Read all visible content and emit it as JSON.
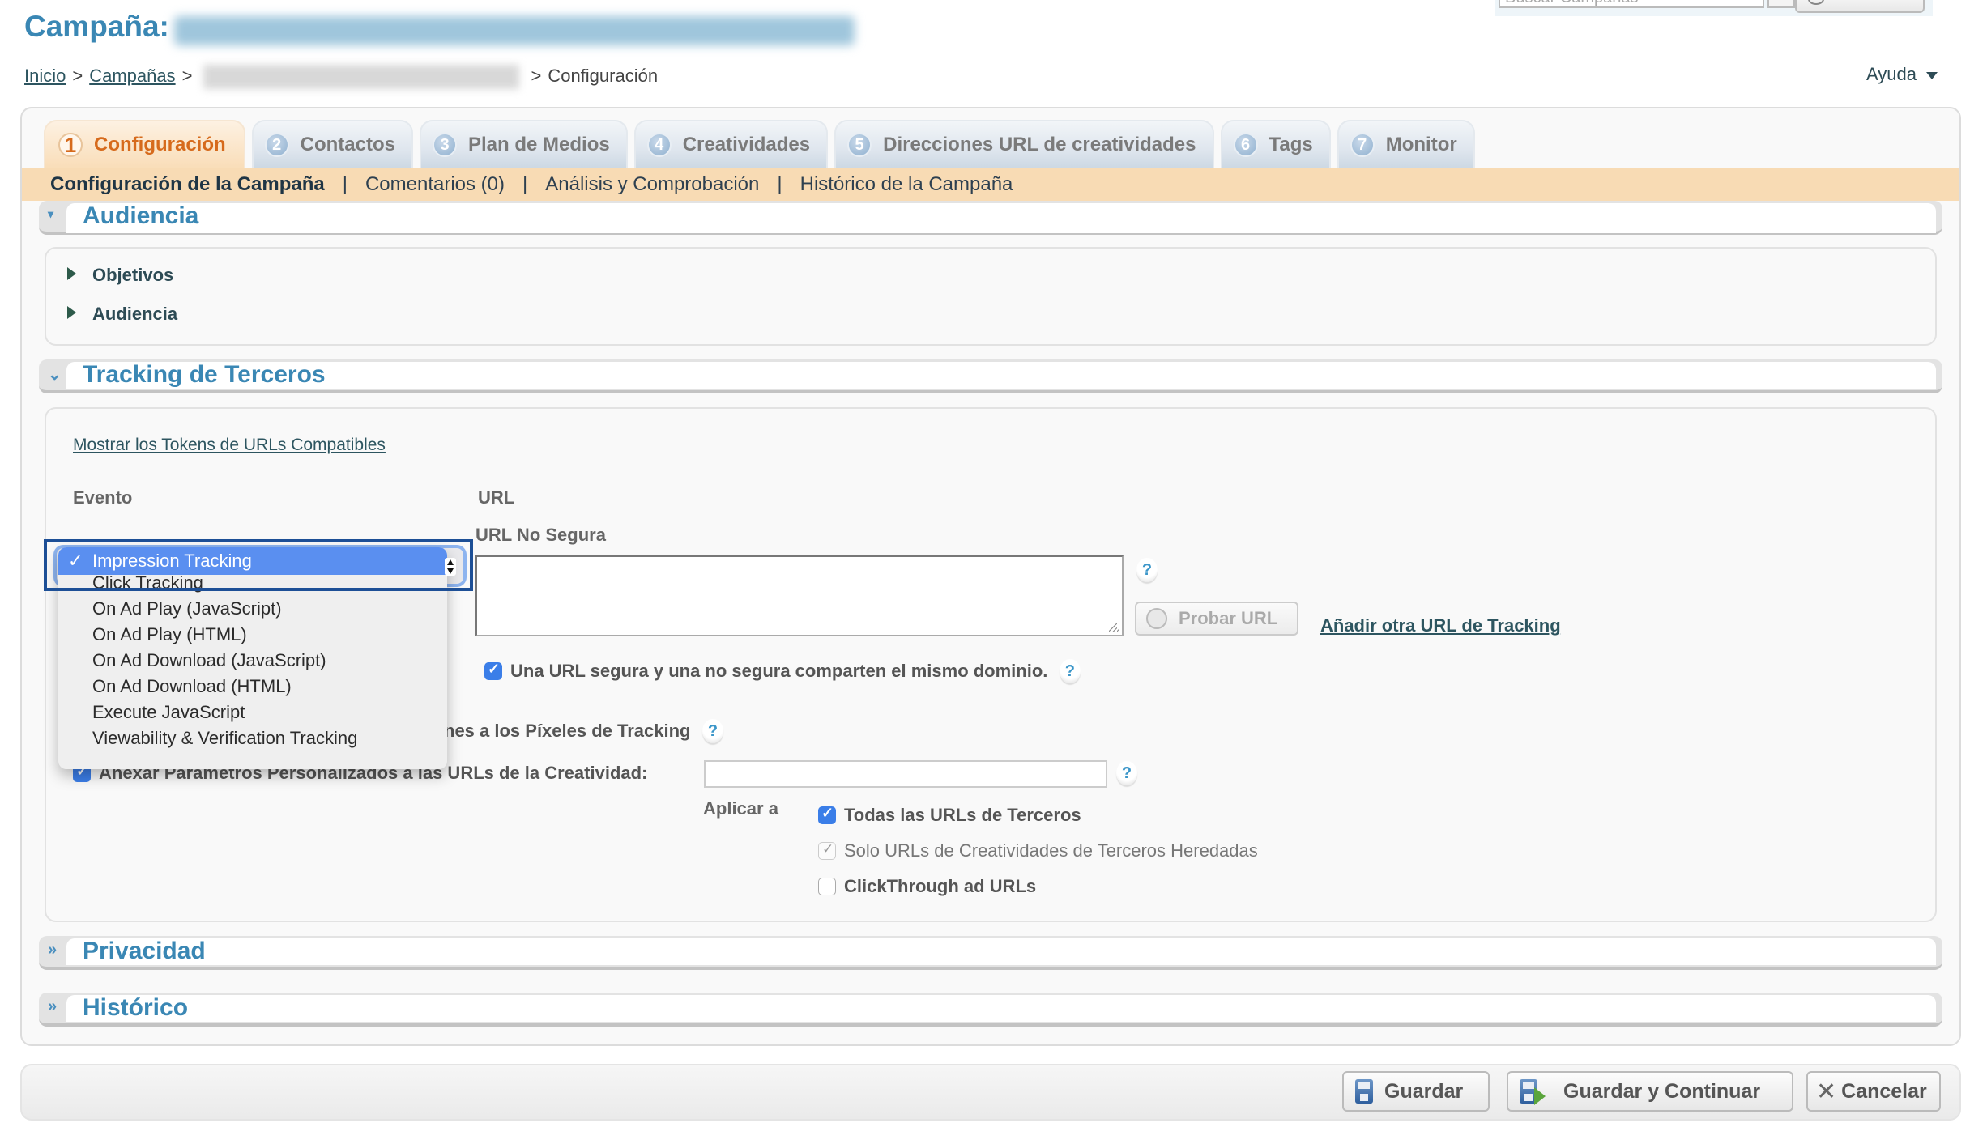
{
  "header": {
    "title_label": "Campaña:",
    "help_label": "Ayuda",
    "search_placeholder": "Buscar Campañas"
  },
  "breadcrumb": {
    "items": [
      "Inicio",
      "Campañas"
    ],
    "separator": ">",
    "current": "Configuración"
  },
  "tabs": [
    {
      "num": "1",
      "label": "Configuración",
      "active": true
    },
    {
      "num": "2",
      "label": "Contactos"
    },
    {
      "num": "3",
      "label": "Plan de Medios"
    },
    {
      "num": "4",
      "label": "Creatividades"
    },
    {
      "num": "5",
      "label": "Direcciones URL de creatividades"
    },
    {
      "num": "6",
      "label": "Tags"
    },
    {
      "num": "7",
      "label": "Monitor"
    }
  ],
  "subnav": {
    "items": [
      "Configuración de la Campaña",
      "Comentarios (0)",
      "Análisis y Comprobación",
      "Histórico de la Campaña"
    ],
    "separator": "|"
  },
  "sections": {
    "audiencia": {
      "title": "Audiencia",
      "children": [
        "Objetivos",
        "Audiencia"
      ]
    },
    "tracking": {
      "title": "Tracking de Terceros"
    },
    "privacidad": {
      "title": "Privacidad"
    },
    "historico": {
      "title": "Histórico"
    }
  },
  "tracking": {
    "tokens_link": "Mostrar los Tokens de URLs Compatibles",
    "col_event": "Evento",
    "col_url": "URL",
    "url_insecure_label": "URL No Segura",
    "url_insecure_value": "",
    "test_url_button": "Probar URL",
    "add_url_link": "Añadir otra URL de Tracking",
    "same_domain_label": "Una URL segura y una no segura comparten el mismo dominio.",
    "same_domain_checked": true,
    "pixels_label_visible": "nes a los Píxeles de Tracking",
    "append_params_label": "Anexar Parámetros Personalizados a las URLs de la Creatividad:",
    "append_params_checked": true,
    "append_params_value": "",
    "apply_to_label": "Aplicar a",
    "apply_options": [
      {
        "label": "Todas las URLs de Terceros",
        "state": "checked"
      },
      {
        "label": "Solo URLs de Creatividades de Terceros Heredadas",
        "state": "disabled-checked"
      },
      {
        "label": "ClickThrough ad URLs",
        "state": "unchecked"
      }
    ],
    "help_glyph": "?"
  },
  "event_dropdown": {
    "selected": "Impression Tracking",
    "check_glyph": "✓",
    "options": [
      "Impression Tracking",
      "Click Tracking",
      "On Ad Play (JavaScript)",
      "On Ad Play (HTML)",
      "On Ad Download (JavaScript)",
      "On Ad Download (HTML)",
      "Execute JavaScript",
      "Viewability & Verification Tracking"
    ]
  },
  "footer": {
    "save": "Guardar",
    "save_continue": "Guardar y Continuar",
    "cancel": "Cancelar"
  },
  "icons": {
    "collapse_chevron": "»",
    "expand_chevron": "¥",
    "cancel_glyph": "✕"
  },
  "colors": {
    "accent_blue": "#3a87b4",
    "active_tab_orange": "#d66a1c",
    "subnav_bg": "#f8dbb4",
    "select_highlight": "#5a8ff0",
    "focus_ring": "#1d4f96",
    "checkbox_blue": "#3b7ee8"
  }
}
